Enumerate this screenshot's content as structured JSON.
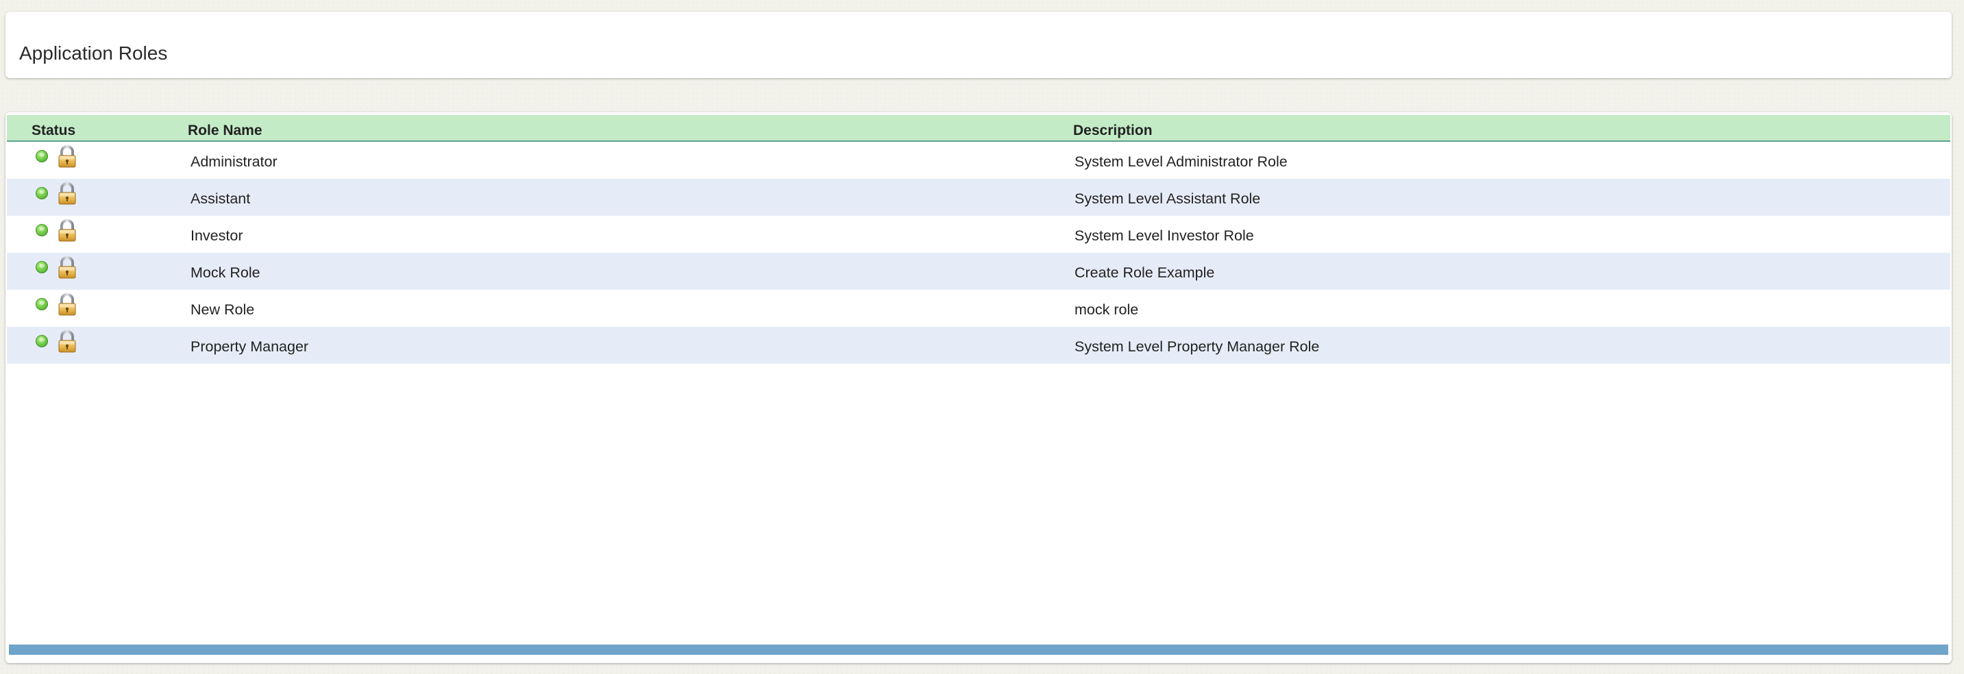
{
  "page": {
    "title": "Application Roles"
  },
  "grid": {
    "columns": {
      "status": "Status",
      "role_name": "Role Name",
      "description": "Description"
    },
    "rows": [
      {
        "status": "active",
        "locked": true,
        "role_name": "Administrator",
        "description": "System Level Administrator Role"
      },
      {
        "status": "active",
        "locked": true,
        "role_name": "Assistant",
        "description": "System Level Assistant Role"
      },
      {
        "status": "active",
        "locked": true,
        "role_name": "Investor",
        "description": "System Level Investor Role"
      },
      {
        "status": "active",
        "locked": true,
        "role_name": "Mock Role",
        "description": "Create Role Example"
      },
      {
        "status": "active",
        "locked": true,
        "role_name": "New Role",
        "description": "mock role"
      },
      {
        "status": "active",
        "locked": true,
        "role_name": "Property Manager",
        "description": "System Level Property Manager Role"
      }
    ]
  },
  "icons": {
    "status": "green-status-dot-icon",
    "lock": "padlock-icon"
  },
  "colors": {
    "header_bg": "#c3ebc6",
    "row_alt_bg": "#e6ecf7",
    "footer_bar": "#6fa4cb",
    "status_active": "#74cc4a"
  }
}
